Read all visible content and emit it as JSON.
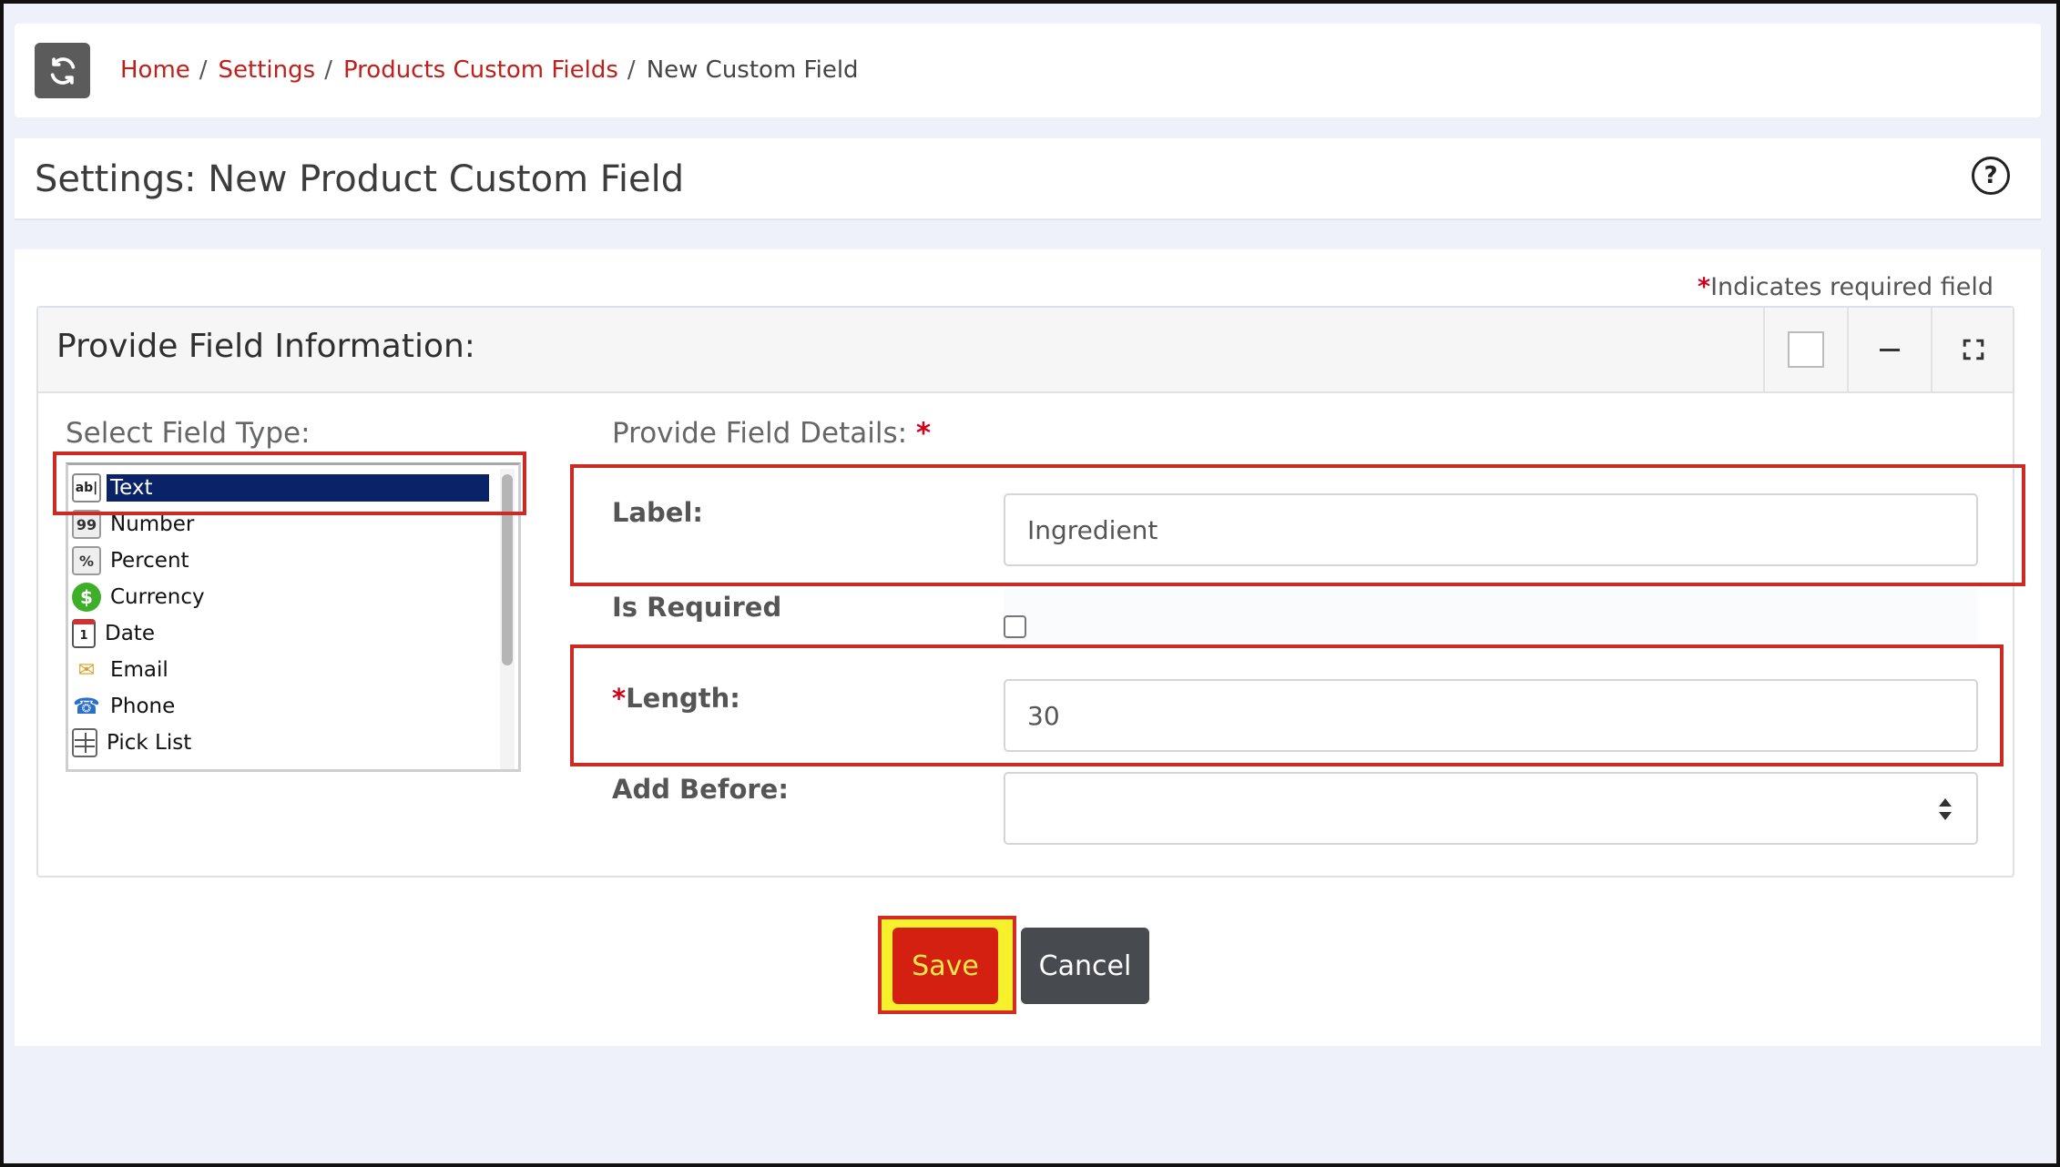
{
  "breadcrumb": {
    "home": "Home",
    "settings": "Settings",
    "products_custom_fields": "Products Custom Fields",
    "current": "New Custom Field",
    "separator": "/"
  },
  "page_title": "Settings: New Product Custom Field",
  "help_icon": "?",
  "required_note": {
    "star": "*",
    "text": "Indicates required field"
  },
  "panel": {
    "title": "Provide Field Information:",
    "field_type": {
      "label": "Select Field Type:",
      "items": [
        {
          "label": "Text",
          "icon": "text-field-icon",
          "selected": true
        },
        {
          "label": "Number",
          "icon": "number-icon"
        },
        {
          "label": "Percent",
          "icon": "percent-icon"
        },
        {
          "label": "Currency",
          "icon": "currency-icon"
        },
        {
          "label": "Date",
          "icon": "calendar-icon"
        },
        {
          "label": "Email",
          "icon": "email-icon"
        },
        {
          "label": "Phone",
          "icon": "phone-icon"
        },
        {
          "label": "Pick List",
          "icon": "pick-list-icon"
        }
      ]
    },
    "details": {
      "label": "Provide Field Details:",
      "star": "*",
      "label_field": {
        "label": "Label:",
        "value": "Ingredient"
      },
      "is_required": {
        "label": "Is Required",
        "checked": false
      },
      "length_field": {
        "star": "*",
        "label": "Length:",
        "value": "30"
      },
      "add_before": {
        "label": "Add Before:",
        "value": ""
      }
    }
  },
  "buttons": {
    "save": "Save",
    "cancel": "Cancel"
  },
  "colors": {
    "link": "#c0201b",
    "selected_item": "#0a2267",
    "save_bg": "#d42010",
    "highlight": "#cc2b24"
  }
}
